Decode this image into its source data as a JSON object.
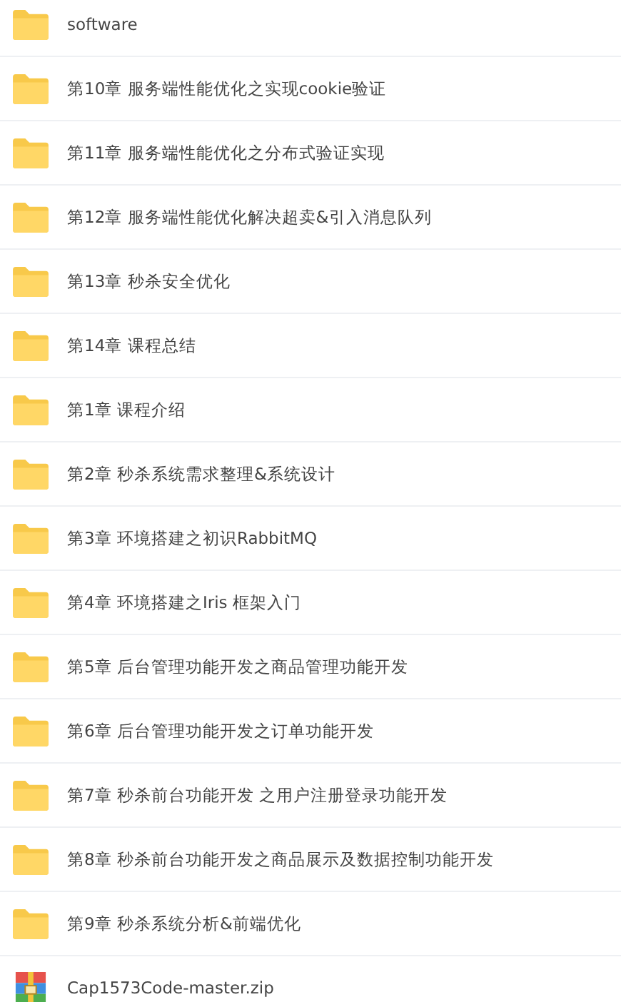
{
  "files": [
    {
      "kind": "folder",
      "name": "software"
    },
    {
      "kind": "folder",
      "name": "第10章 服务端性能优化之实现cookie验证"
    },
    {
      "kind": "folder",
      "name": "第11章 服务端性能优化之分布式验证实现"
    },
    {
      "kind": "folder",
      "name": "第12章 服务端性能优化解决超卖&引入消息队列"
    },
    {
      "kind": "folder",
      "name": "第13章 秒杀安全优化"
    },
    {
      "kind": "folder",
      "name": "第14章 课程总结"
    },
    {
      "kind": "folder",
      "name": "第1章 课程介绍"
    },
    {
      "kind": "folder",
      "name": "第2章 秒杀系统需求整理&系统设计"
    },
    {
      "kind": "folder",
      "name": "第3章 环境搭建之初识RabbitMQ"
    },
    {
      "kind": "folder",
      "name": "第4章 环境搭建之Iris 框架入门"
    },
    {
      "kind": "folder",
      "name": "第5章 后台管理功能开发之商品管理功能开发"
    },
    {
      "kind": "folder",
      "name": "第6章 后台管理功能开发之订单功能开发"
    },
    {
      "kind": "folder",
      "name": "第7章 秒杀前台功能开发 之用户注册登录功能开发"
    },
    {
      "kind": "folder",
      "name": "第8章 秒杀前台功能开发之商品展示及数据控制功能开发"
    },
    {
      "kind": "folder",
      "name": "第9章 秒杀系统分析&前端优化"
    },
    {
      "kind": "zip",
      "name": "Cap1573Code-master.zip"
    }
  ]
}
